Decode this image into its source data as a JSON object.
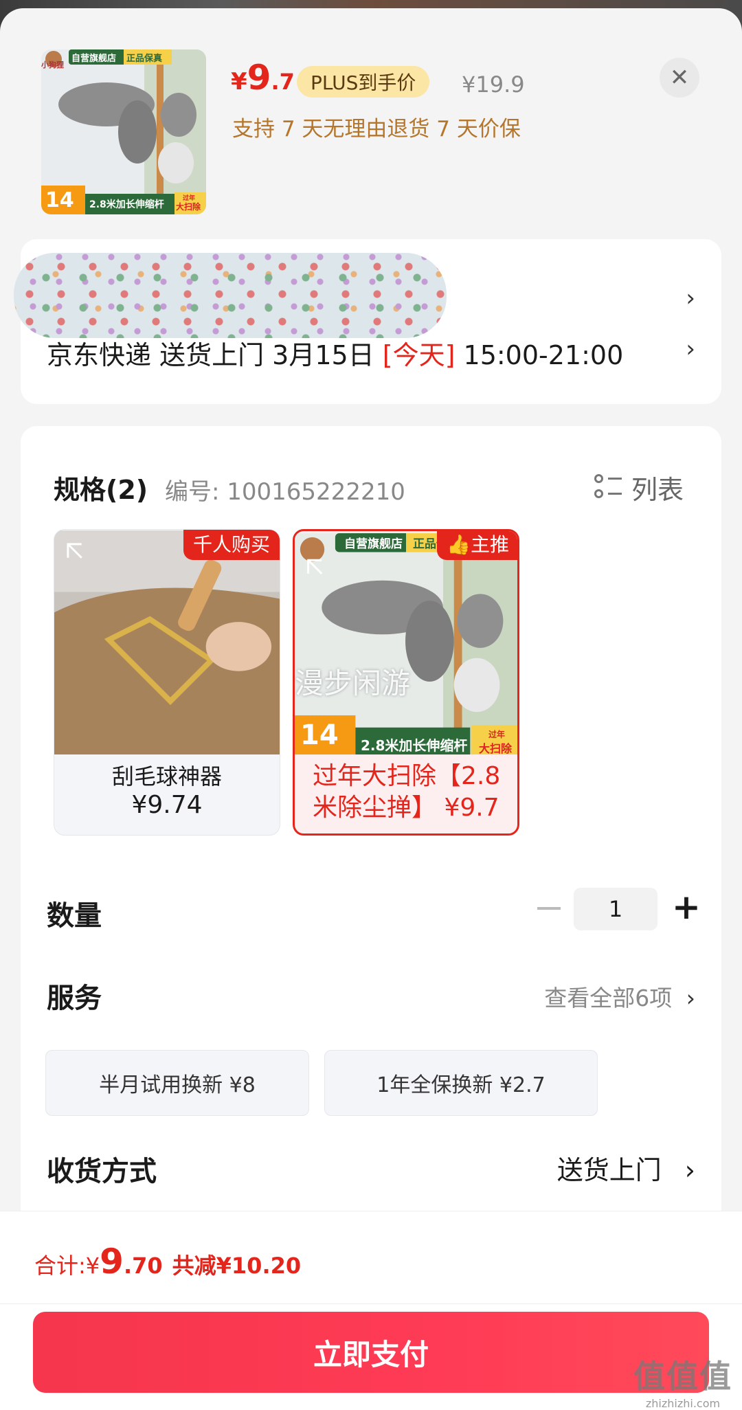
{
  "product": {
    "thumb_brand": "小狗狸",
    "thumb_store_badge": "自营旗舰店",
    "thumb_genuine_badge": "正品保真",
    "thumb_price_tag": "14",
    "thumb_caption": "2.8米加长伸缩杆",
    "thumb_promo_small": "过年",
    "thumb_promo": "大扫除",
    "price_currency": "¥",
    "price_int": "9",
    "price_dec": ".7",
    "plus_badge": "PLUS到手价",
    "original_price": "¥19.9",
    "guarantee": "支持 7 天无理由退货  7 天价保"
  },
  "address": {
    "delivery_prefix": "京东快递 送货上门 3月15日 ",
    "delivery_today": "[今天]",
    "delivery_time": " 15:00-21:00"
  },
  "spec": {
    "title": "规格(2)",
    "code": "编号: 100165222210",
    "list_toggle": "列表",
    "options": [
      {
        "tag": "千人购买",
        "label_line1": "刮毛球神器",
        "label_line2": "¥9.74"
      },
      {
        "tag": "主推",
        "label": "过年大扫除【2.8米除尘掸】 ¥9.7",
        "overlay_text": "漫步闲游"
      }
    ]
  },
  "quantity": {
    "label": "数量",
    "value": "1",
    "minus": "−",
    "plus": "+"
  },
  "service": {
    "label": "服务",
    "view_all": "查看全部6项",
    "chips": [
      "半月试用换新  ¥8",
      "1年全保换新  ¥2.7"
    ]
  },
  "receive": {
    "label": "收货方式",
    "value": "送货上门"
  },
  "footer": {
    "total_label": "合计: ",
    "total_currency": "¥",
    "total_int": "9",
    "total_dec": ".70",
    "discount": "共减¥10.20",
    "pay_button": "立即支付"
  },
  "watermark": {
    "glyphs": "值值值",
    "url": "zhizhizhi.com"
  },
  "icons": {
    "close": "close-icon",
    "chevron": "chevron-right-icon",
    "list": "list-icon",
    "thumbs_up": "thumbs-up-icon",
    "expand": "expand-icon"
  },
  "colors": {
    "accent_red": "#e4251b",
    "plus_gold": "#fbe6a6",
    "guarantee_brown": "#b5762b"
  }
}
